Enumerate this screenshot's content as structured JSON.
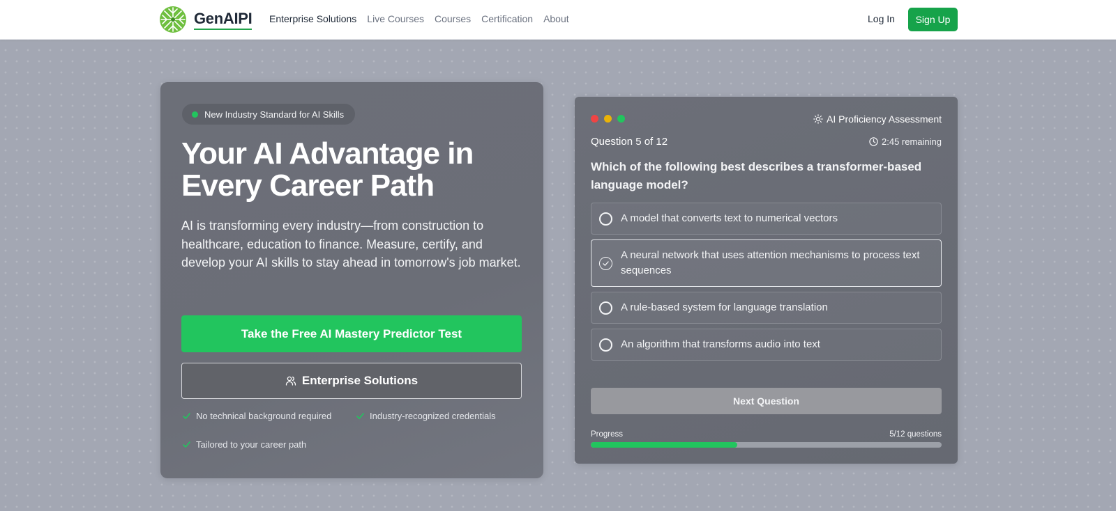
{
  "brand": {
    "name": "GenAIPI"
  },
  "nav": {
    "links": [
      {
        "label": "Enterprise Solutions",
        "active": true
      },
      {
        "label": "Live Courses",
        "active": false
      },
      {
        "label": "Courses",
        "active": false
      },
      {
        "label": "Certification",
        "active": false
      },
      {
        "label": "About",
        "active": false
      }
    ],
    "login_label": "Log In",
    "signup_label": "Sign Up"
  },
  "hero": {
    "badge": "New Industry Standard for AI Skills",
    "title": "Your AI Advantage in Every Career Path",
    "description": "AI is transforming every industry—from construction to healthcare, education to finance. Measure, certify, and develop your AI skills to stay ahead in tomorrow's job market.",
    "cta_primary": "Take the Free AI Mastery Predictor Test",
    "cta_secondary": "Enterprise Solutions",
    "features": [
      "No technical background required",
      "Industry-recognized credentials",
      "Tailored to your career path"
    ]
  },
  "quiz": {
    "window_dots": [
      "#ef4444",
      "#eab308",
      "#22c55e"
    ],
    "assessment_label": "AI Proficiency Assessment",
    "question_counter": "Question 5 of 12",
    "timer": "2:45 remaining",
    "question": "Which of the following best describes a transformer-based language model?",
    "options": [
      {
        "label": "A model that converts text to numerical vectors",
        "selected": false
      },
      {
        "label": "A neural network that uses attention mechanisms to process text sequences",
        "selected": true
      },
      {
        "label": "A rule-based system for language translation",
        "selected": false
      },
      {
        "label": "An algorithm that transforms audio into text",
        "selected": false
      }
    ],
    "next_label": "Next Question",
    "progress": {
      "label": "Progress",
      "count_text": "5/12 questions",
      "fraction": 0.4167
    }
  },
  "colors": {
    "accent": "#22c55e",
    "brand_green": "#16a34a"
  },
  "icons": {
    "logo": "leaf-burst-logo-icon",
    "secondary_cta": "users-icon",
    "feature": "check-icon",
    "assessment": "sun-icon",
    "timer": "clock-icon"
  }
}
